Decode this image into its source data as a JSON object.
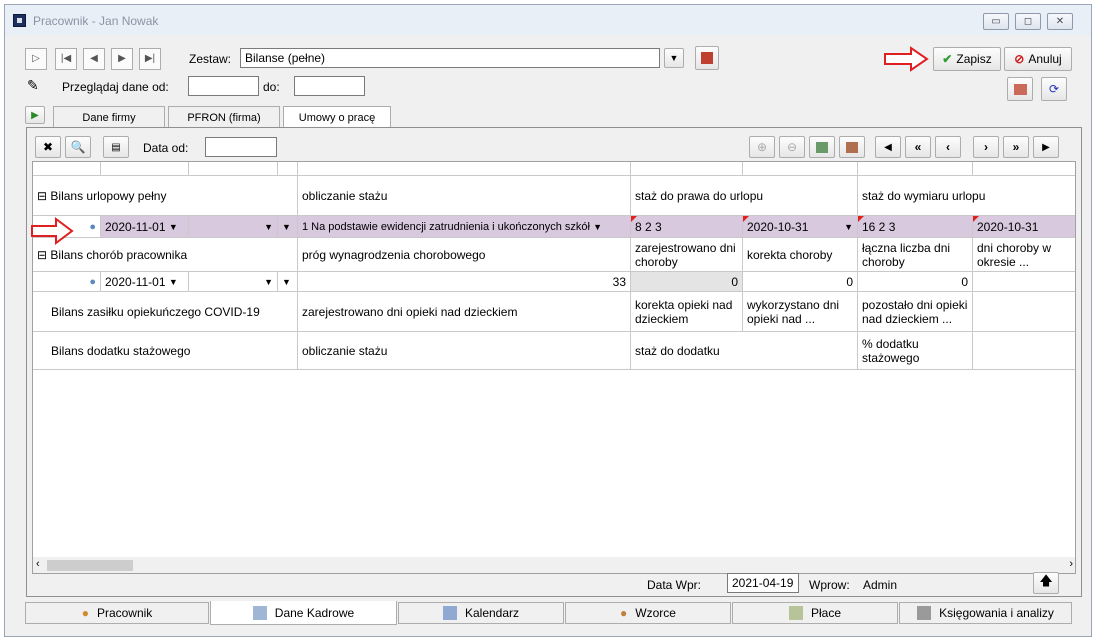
{
  "window": {
    "title": "Pracownik - Jan Nowak"
  },
  "toolbar": {
    "zestaw_label": "Zestaw:",
    "zestaw_value": "Bilanse (pełne)",
    "przegladaj_label": "Przeglądaj dane od:",
    "do_label": "do:",
    "zapisz": "Zapisz",
    "anuluj": "Anuluj"
  },
  "tabs": [
    "Dane firmy",
    "PFRON (firma)",
    "Umowy o pracę"
  ],
  "panel": {
    "data_od_label": "Data od:"
  },
  "grid": {
    "rows": [
      {
        "label": "Bilans urlopowy pełny",
        "col2": "obliczanie stażu",
        "col3": "staż do prawa do urlopu",
        "col4": "",
        "col5": "staż do wymiaru urlopu",
        "col6": ""
      },
      {
        "date": "2020-11-01",
        "col2": "1 Na podstawie ewidencji zatrudnienia i ukończonych szkół",
        "col3": "8  2  3",
        "col4": "2020-10-31",
        "col5": "16  2  3",
        "col6": "2020-10-31"
      },
      {
        "label": "Bilans chorób pracownika",
        "col2": "próg wynagrodzenia chorobowego",
        "col3": "zarejestrowano dni choroby",
        "col4": "korekta choroby",
        "col5": "łączna liczba dni choroby",
        "col6": "dni choroby w okresie ..."
      },
      {
        "date": "2020-11-01",
        "col2": "33",
        "col3": "0",
        "col4": "0",
        "col5": "0",
        "col6": ""
      },
      {
        "label": "Bilans zasiłku opiekuńczego COVID-19",
        "col2": "zarejestrowano dni opieki nad dzieckiem",
        "col3": "korekta opieki nad dzieckiem",
        "col4": "wykorzystano dni opieki nad ...",
        "col5": "pozostało dni opieki nad dzieckiem ...",
        "col6": ""
      },
      {
        "label": "Bilans dodatku stażowego",
        "col2": "obliczanie stażu",
        "col3": "staż do dodatku",
        "col4": "",
        "col5": "% dodatku stażowego",
        "col6": ""
      }
    ]
  },
  "status": {
    "data_wpr_label": "Data Wpr:",
    "data_wpr_value": "2021-04-19",
    "wprow_label": "Wprow:",
    "wprow_value": "Admin"
  },
  "bottom_tabs": [
    "Pracownik",
    "Dane Kadrowe",
    "Kalendarz",
    "Wzorce",
    "Płace",
    "Księgowania i analizy"
  ],
  "colors": {
    "selected_row": "#d8c9df",
    "arrow": "#e02020"
  }
}
